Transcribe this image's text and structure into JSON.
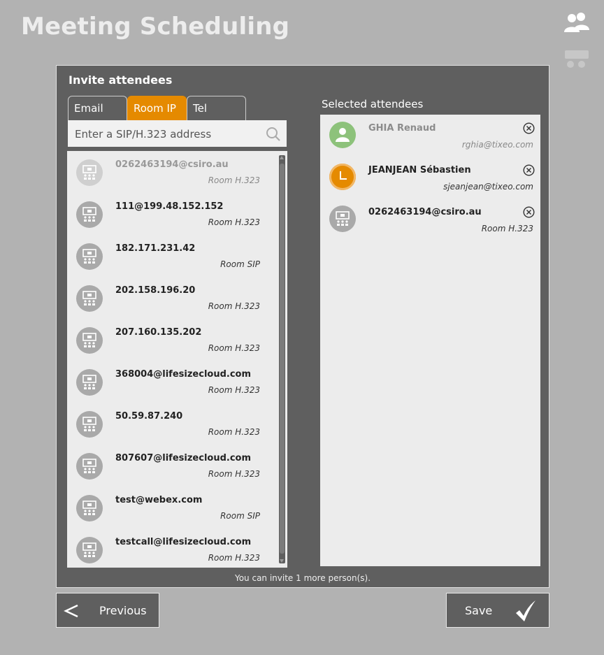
{
  "header": {
    "title": "Meeting Scheduling"
  },
  "panel": {
    "title": "Invite attendees",
    "tabs": [
      {
        "label": "Email",
        "active": false
      },
      {
        "label": "Room IP",
        "active": true
      },
      {
        "label": "Tel",
        "active": false
      }
    ],
    "search_placeholder": "Enter a SIP/H.323 address",
    "directory": [
      {
        "address": "0262463194@csiro.au",
        "type": "Room H.323",
        "dimmed": true
      },
      {
        "address": "111@199.48.152.152",
        "type": "Room H.323"
      },
      {
        "address": "182.171.231.42",
        "type": "Room SIP"
      },
      {
        "address": "202.158.196.20",
        "type": "Room H.323"
      },
      {
        "address": "207.160.135.202",
        "type": "Room H.323"
      },
      {
        "address": "368004@lifesizecloud.com",
        "type": "Room H.323"
      },
      {
        "address": "50.59.87.240",
        "type": "Room H.323"
      },
      {
        "address": "807607@lifesizecloud.com",
        "type": "Room H.323"
      },
      {
        "address": "test@webex.com",
        "type": "Room SIP"
      },
      {
        "address": "testcall@lifesizecloud.com",
        "type": "Room H.323"
      }
    ],
    "selected_label": "Selected attendees",
    "selected": [
      {
        "name": "GHIA Renaud",
        "sub": "rghia@tixeo.com",
        "avatar": "person-icon"
      },
      {
        "name": "JEANJEAN Sébastien",
        "sub": "sjeanjean@tixeo.com",
        "avatar": "clock-icon"
      },
      {
        "name": "0262463194@csiro.au",
        "sub": "Room H.323",
        "avatar": "room-icon"
      }
    ],
    "invite_note": "You can invite 1 more person(s)."
  },
  "buttons": {
    "previous": "Previous",
    "save": "Save"
  },
  "colors": {
    "accent": "#e58a00",
    "panel": "#5f5f5f",
    "background": "#b2b2b2",
    "online": "#8dc27b"
  }
}
